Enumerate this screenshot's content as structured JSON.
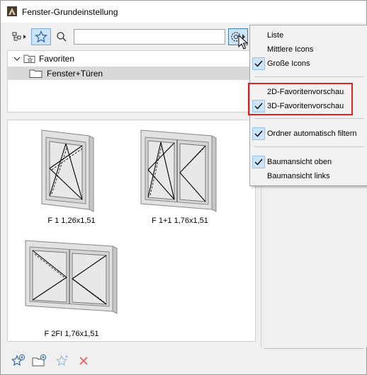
{
  "window": {
    "title": "Fenster-Grundeinstellung"
  },
  "toolbar": {
    "search": {
      "value": "",
      "placeholder": ""
    }
  },
  "tree": {
    "root_label": "Favoriten",
    "child_label": "Fenster+Türen"
  },
  "items": [
    {
      "label": "F 1 1,26x1,51"
    },
    {
      "label": "F 1+1 1,76x1,51"
    },
    {
      "label": "F 2FI 1,76x1,51"
    }
  ],
  "menu": {
    "items": [
      {
        "label": "Liste",
        "checked": false
      },
      {
        "label": "Mittlere Icons",
        "checked": false
      },
      {
        "label": "Große Icons",
        "checked": true
      },
      {
        "label": "2D-Favoritenvorschau",
        "checked": false
      },
      {
        "label": "3D-Favoritenvorschau",
        "checked": true
      },
      {
        "label": "Ordner automatisch filtern",
        "checked": true
      },
      {
        "label": "Baumansicht oben",
        "checked": true
      },
      {
        "label": "Baumansicht links",
        "checked": false
      }
    ]
  },
  "colors": {
    "accent": "#cce4f7",
    "highlight": "#e02020",
    "delete": "#e06060"
  }
}
